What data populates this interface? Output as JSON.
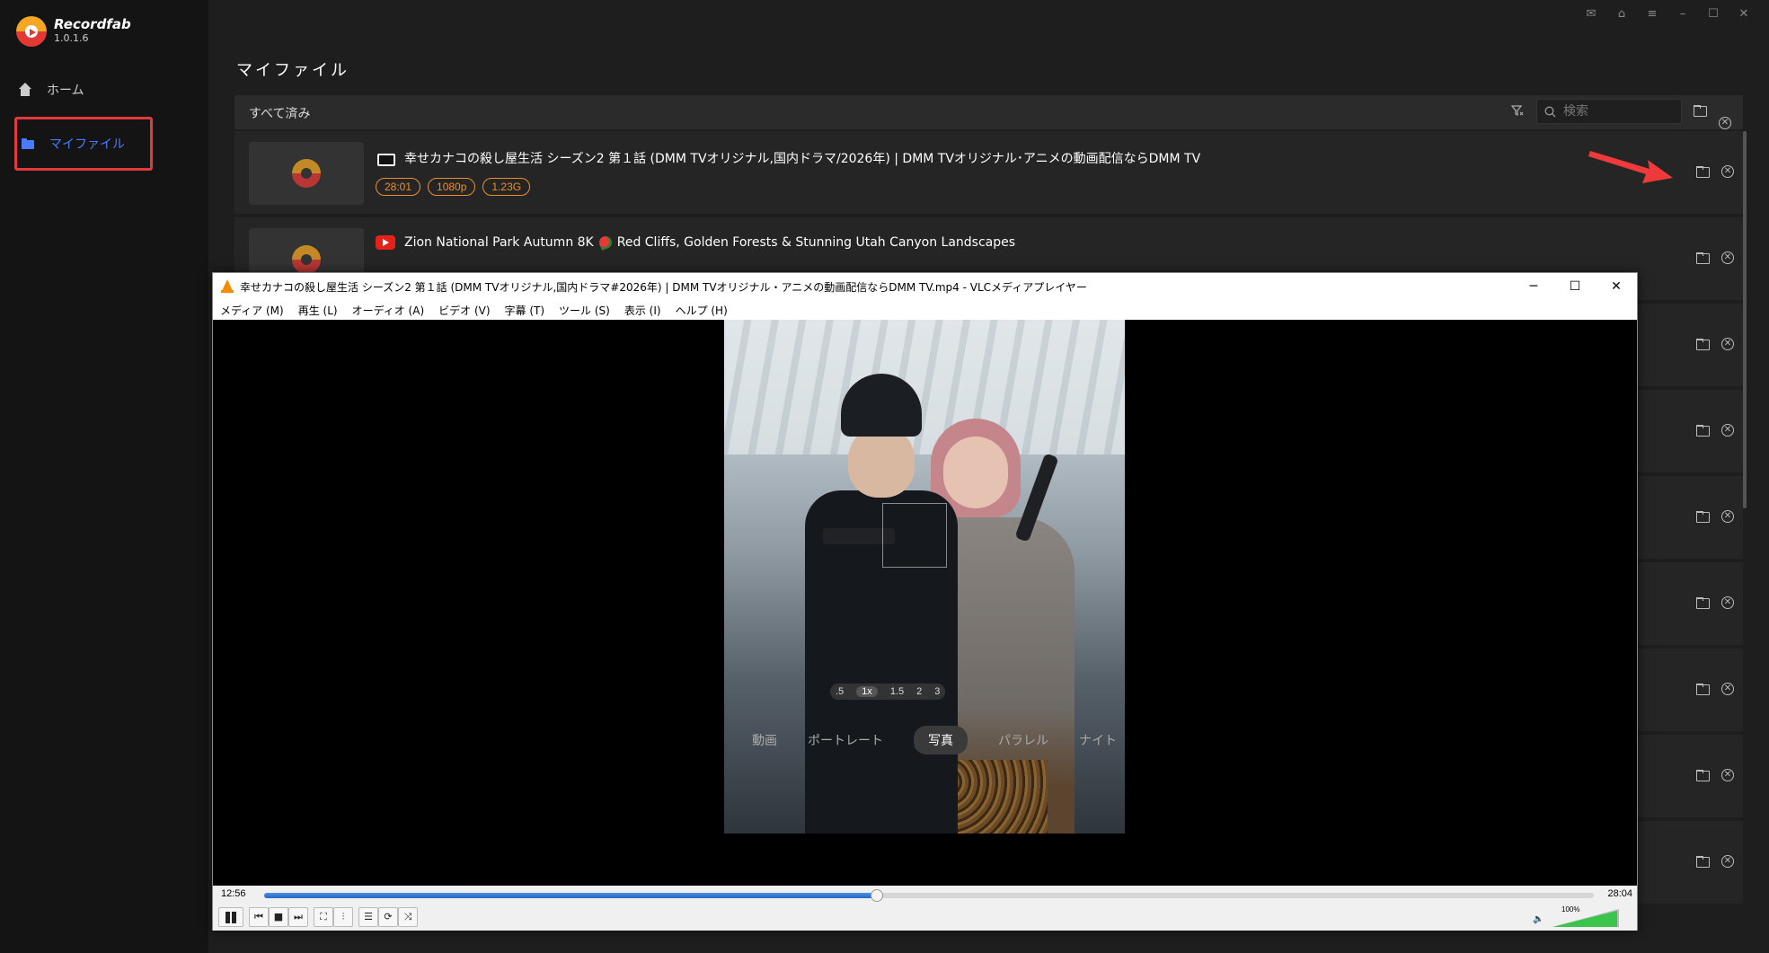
{
  "app": {
    "name": "Recordfab",
    "version": "1.0.1.6"
  },
  "sidebar": {
    "items": [
      {
        "label": "ホーム",
        "icon": "home-icon"
      },
      {
        "label": "マイファイル",
        "icon": "folder-icon"
      }
    ]
  },
  "colors": {
    "accent_blue": "#4a7bff",
    "tag_orange": "#e8902b",
    "highlight_red": "#e53940",
    "vlc_progress": "#2468c8",
    "volume_green": "#3bc44b"
  },
  "main": {
    "title": "マイファイル",
    "filter_label": "すべて済み",
    "search": {
      "placeholder": "検索"
    }
  },
  "files": [
    {
      "title": "幸せカナコの殺し屋生活 シーズン2 第１話 (DMM TVオリジナル,国内ドラマ/2026年) | DMM TVオリジナル･アニメの動画配信ならDMM TV",
      "source": "dmm",
      "tags": [
        "28:01",
        "1080p",
        "1.23G"
      ]
    },
    {
      "title_part1": "Zion National Park Autumn 8K",
      "title_part2": "Red Cliffs, Golden Forests & Stunning Utah Canyon Landscapes",
      "source": "youtube"
    }
  ],
  "vlc": {
    "title": "幸せカナコの殺し屋生活 シーズン2 第１話 (DMM TVオリジナル,国内ドラマ#2026年) | DMM TVオリジナル・アニメの動画配信ならDMM TV.mp4 - VLCメディアプレイヤー",
    "menu": [
      "メディア (M)",
      "再生 (L)",
      "オーディオ (A)",
      "ビデオ (V)",
      "字幕 (T)",
      "ツール (S)",
      "表示 (I)",
      "ヘルプ (H)"
    ],
    "zoom_levels": [
      ".5",
      "1x",
      "1.5",
      "2",
      "3"
    ],
    "camera_modes": [
      "動画",
      "ポートレート",
      "写真",
      "パラレル",
      "ナイト"
    ],
    "active_mode": "写真",
    "time_elapsed": "12:56",
    "time_total": "28:04",
    "progress_fraction": 0.461,
    "volume_label": "100%",
    "volume_fraction": 1.0
  }
}
